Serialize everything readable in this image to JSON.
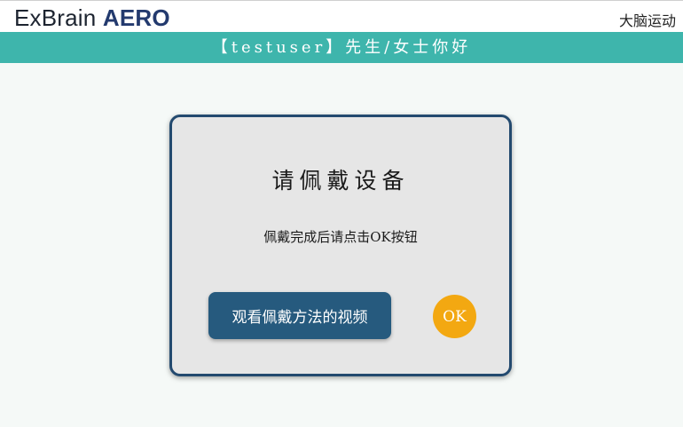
{
  "header": {
    "logo_prefix": "ExBrain",
    "logo_suffix": "AERO",
    "corner_text": "大脑运动"
  },
  "banner": {
    "greeting": "【testuser】先生/女士你好"
  },
  "dialog": {
    "title": "请佩戴设备",
    "message": "佩戴完成后请点击OK按钮",
    "video_button_label": "观看佩戴方法的视频",
    "ok_button_label": "OK"
  },
  "colors": {
    "banner": "#3eb5ac",
    "dialog_border": "#234a6f",
    "video_button": "#265a7e",
    "ok_button": "#f3a811"
  }
}
